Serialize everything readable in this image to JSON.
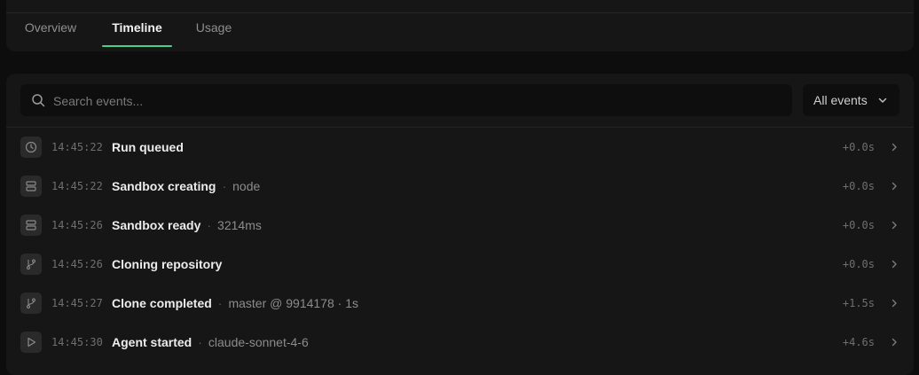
{
  "tabs": [
    {
      "label": "Overview",
      "active": false
    },
    {
      "label": "Timeline",
      "active": true
    },
    {
      "label": "Usage",
      "active": false
    }
  ],
  "search": {
    "placeholder": "Search events...",
    "value": ""
  },
  "filter": {
    "label": "All events"
  },
  "events": [
    {
      "icon": "clock-icon",
      "time": "14:45:22",
      "title": "Run queued",
      "detail": "",
      "delta": "+0.0s"
    },
    {
      "icon": "server-icon",
      "time": "14:45:22",
      "title": "Sandbox creating",
      "detail": "node",
      "delta": "+0.0s"
    },
    {
      "icon": "server-icon",
      "time": "14:45:26",
      "title": "Sandbox ready",
      "detail": "3214ms",
      "delta": "+0.0s"
    },
    {
      "icon": "git-branch-icon",
      "time": "14:45:26",
      "title": "Cloning repository",
      "detail": "",
      "delta": "+0.0s"
    },
    {
      "icon": "git-branch-icon",
      "time": "14:45:27",
      "title": "Clone completed",
      "detail": "master @ 9914178 · 1s",
      "delta": "+1.5s"
    },
    {
      "icon": "play-icon",
      "time": "14:45:30",
      "title": "Agent started",
      "detail": "claude-sonnet-4-6",
      "delta": "+4.6s"
    }
  ],
  "colors": {
    "accent": "#4ccf8a",
    "background": "#0d0d0d",
    "card": "#161616"
  }
}
